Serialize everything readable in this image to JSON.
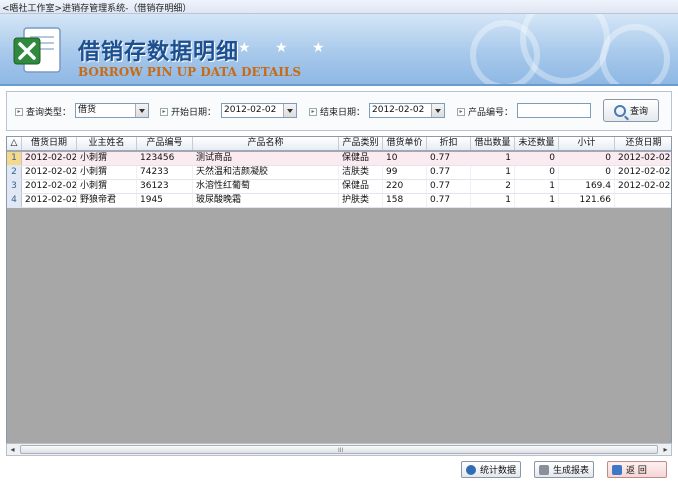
{
  "window": {
    "title": "<晤社工作室>进销存管理系统-（借销存明细）"
  },
  "banner": {
    "title": "借销存数据明细",
    "stars": "★ ★ ★",
    "subtitle": "BORROW PIN UP DATA DETAILS"
  },
  "query": {
    "type_label": "查询类型：",
    "type_value": "借货",
    "start_label": "开始日期：",
    "start_value": "2012-02-02",
    "end_label": "结束日期：",
    "end_value": "2012-02-02",
    "product_label": "产品编号：",
    "product_value": "",
    "search_button": "查询"
  },
  "table": {
    "corner": "△",
    "headers": [
      "借货日期",
      "业主姓名",
      "产品编号",
      "产品名称",
      "产品类别",
      "借货单价",
      "折扣",
      "借出数量",
      "未还数量",
      "小计",
      "还货日期"
    ],
    "rows": [
      {
        "idx": "1",
        "date": "2012-02-02",
        "owner": "小刺猬",
        "code": "123456",
        "name": "测试商品",
        "category": "保健品",
        "price": "10",
        "discount": "0.77",
        "lent": "1",
        "unreturned": "0",
        "subtotal": "0",
        "return_date": "2012-02-02"
      },
      {
        "idx": "2",
        "date": "2012-02-02",
        "owner": "小刺猬",
        "code": "74233",
        "name": "天然温和洁颜凝胶",
        "category": "洁肤类",
        "price": "99",
        "discount": "0.77",
        "lent": "1",
        "unreturned": "0",
        "subtotal": "0",
        "return_date": "2012-02-02"
      },
      {
        "idx": "3",
        "date": "2012-02-02",
        "owner": "小刺猬",
        "code": "36123",
        "name": "水溶性红葡萄",
        "category": "保健品",
        "price": "220",
        "discount": "0.77",
        "lent": "2",
        "unreturned": "1",
        "subtotal": "169.4",
        "return_date": "2012-02-02"
      },
      {
        "idx": "4",
        "date": "2012-02-02",
        "owner": "野狼帝君",
        "code": "1945",
        "name": "玻尿酸晚霜",
        "category": "护肤类",
        "price": "158",
        "discount": "0.77",
        "lent": "1",
        "unreturned": "1",
        "subtotal": "121.66",
        "return_date": ""
      }
    ],
    "selected_row": 1
  },
  "scrollbar": {
    "left": "◂",
    "right": "▸",
    "grip": "III"
  },
  "footer": {
    "stats_button": "统计数据",
    "report_button": "生成报表",
    "back_button": "返  回"
  },
  "colors": {
    "banner_title": "#1c4f8f",
    "banner_subtitle": "#c96a12",
    "grid_empty": "#a7a7a7"
  }
}
